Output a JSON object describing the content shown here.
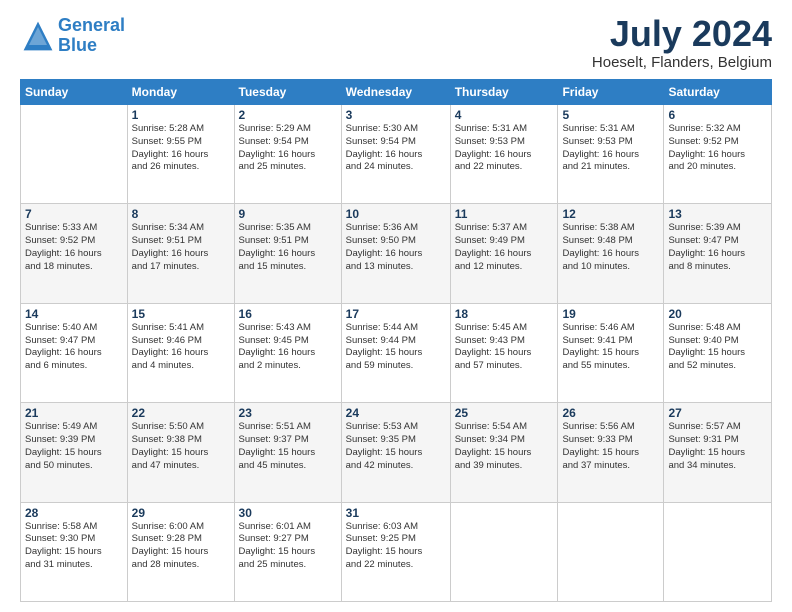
{
  "header": {
    "logo_line1": "General",
    "logo_line2": "Blue",
    "month": "July 2024",
    "location": "Hoeselt, Flanders, Belgium"
  },
  "days_of_week": [
    "Sunday",
    "Monday",
    "Tuesday",
    "Wednesday",
    "Thursday",
    "Friday",
    "Saturday"
  ],
  "weeks": [
    [
      {
        "day": "",
        "info": ""
      },
      {
        "day": "1",
        "info": "Sunrise: 5:28 AM\nSunset: 9:55 PM\nDaylight: 16 hours\nand 26 minutes."
      },
      {
        "day": "2",
        "info": "Sunrise: 5:29 AM\nSunset: 9:54 PM\nDaylight: 16 hours\nand 25 minutes."
      },
      {
        "day": "3",
        "info": "Sunrise: 5:30 AM\nSunset: 9:54 PM\nDaylight: 16 hours\nand 24 minutes."
      },
      {
        "day": "4",
        "info": "Sunrise: 5:31 AM\nSunset: 9:53 PM\nDaylight: 16 hours\nand 22 minutes."
      },
      {
        "day": "5",
        "info": "Sunrise: 5:31 AM\nSunset: 9:53 PM\nDaylight: 16 hours\nand 21 minutes."
      },
      {
        "day": "6",
        "info": "Sunrise: 5:32 AM\nSunset: 9:52 PM\nDaylight: 16 hours\nand 20 minutes."
      }
    ],
    [
      {
        "day": "7",
        "info": "Sunrise: 5:33 AM\nSunset: 9:52 PM\nDaylight: 16 hours\nand 18 minutes."
      },
      {
        "day": "8",
        "info": "Sunrise: 5:34 AM\nSunset: 9:51 PM\nDaylight: 16 hours\nand 17 minutes."
      },
      {
        "day": "9",
        "info": "Sunrise: 5:35 AM\nSunset: 9:51 PM\nDaylight: 16 hours\nand 15 minutes."
      },
      {
        "day": "10",
        "info": "Sunrise: 5:36 AM\nSunset: 9:50 PM\nDaylight: 16 hours\nand 13 minutes."
      },
      {
        "day": "11",
        "info": "Sunrise: 5:37 AM\nSunset: 9:49 PM\nDaylight: 16 hours\nand 12 minutes."
      },
      {
        "day": "12",
        "info": "Sunrise: 5:38 AM\nSunset: 9:48 PM\nDaylight: 16 hours\nand 10 minutes."
      },
      {
        "day": "13",
        "info": "Sunrise: 5:39 AM\nSunset: 9:47 PM\nDaylight: 16 hours\nand 8 minutes."
      }
    ],
    [
      {
        "day": "14",
        "info": "Sunrise: 5:40 AM\nSunset: 9:47 PM\nDaylight: 16 hours\nand 6 minutes."
      },
      {
        "day": "15",
        "info": "Sunrise: 5:41 AM\nSunset: 9:46 PM\nDaylight: 16 hours\nand 4 minutes."
      },
      {
        "day": "16",
        "info": "Sunrise: 5:43 AM\nSunset: 9:45 PM\nDaylight: 16 hours\nand 2 minutes."
      },
      {
        "day": "17",
        "info": "Sunrise: 5:44 AM\nSunset: 9:44 PM\nDaylight: 15 hours\nand 59 minutes."
      },
      {
        "day": "18",
        "info": "Sunrise: 5:45 AM\nSunset: 9:43 PM\nDaylight: 15 hours\nand 57 minutes."
      },
      {
        "day": "19",
        "info": "Sunrise: 5:46 AM\nSunset: 9:41 PM\nDaylight: 15 hours\nand 55 minutes."
      },
      {
        "day": "20",
        "info": "Sunrise: 5:48 AM\nSunset: 9:40 PM\nDaylight: 15 hours\nand 52 minutes."
      }
    ],
    [
      {
        "day": "21",
        "info": "Sunrise: 5:49 AM\nSunset: 9:39 PM\nDaylight: 15 hours\nand 50 minutes."
      },
      {
        "day": "22",
        "info": "Sunrise: 5:50 AM\nSunset: 9:38 PM\nDaylight: 15 hours\nand 47 minutes."
      },
      {
        "day": "23",
        "info": "Sunrise: 5:51 AM\nSunset: 9:37 PM\nDaylight: 15 hours\nand 45 minutes."
      },
      {
        "day": "24",
        "info": "Sunrise: 5:53 AM\nSunset: 9:35 PM\nDaylight: 15 hours\nand 42 minutes."
      },
      {
        "day": "25",
        "info": "Sunrise: 5:54 AM\nSunset: 9:34 PM\nDaylight: 15 hours\nand 39 minutes."
      },
      {
        "day": "26",
        "info": "Sunrise: 5:56 AM\nSunset: 9:33 PM\nDaylight: 15 hours\nand 37 minutes."
      },
      {
        "day": "27",
        "info": "Sunrise: 5:57 AM\nSunset: 9:31 PM\nDaylight: 15 hours\nand 34 minutes."
      }
    ],
    [
      {
        "day": "28",
        "info": "Sunrise: 5:58 AM\nSunset: 9:30 PM\nDaylight: 15 hours\nand 31 minutes."
      },
      {
        "day": "29",
        "info": "Sunrise: 6:00 AM\nSunset: 9:28 PM\nDaylight: 15 hours\nand 28 minutes."
      },
      {
        "day": "30",
        "info": "Sunrise: 6:01 AM\nSunset: 9:27 PM\nDaylight: 15 hours\nand 25 minutes."
      },
      {
        "day": "31",
        "info": "Sunrise: 6:03 AM\nSunset: 9:25 PM\nDaylight: 15 hours\nand 22 minutes."
      },
      {
        "day": "",
        "info": ""
      },
      {
        "day": "",
        "info": ""
      },
      {
        "day": "",
        "info": ""
      }
    ]
  ]
}
